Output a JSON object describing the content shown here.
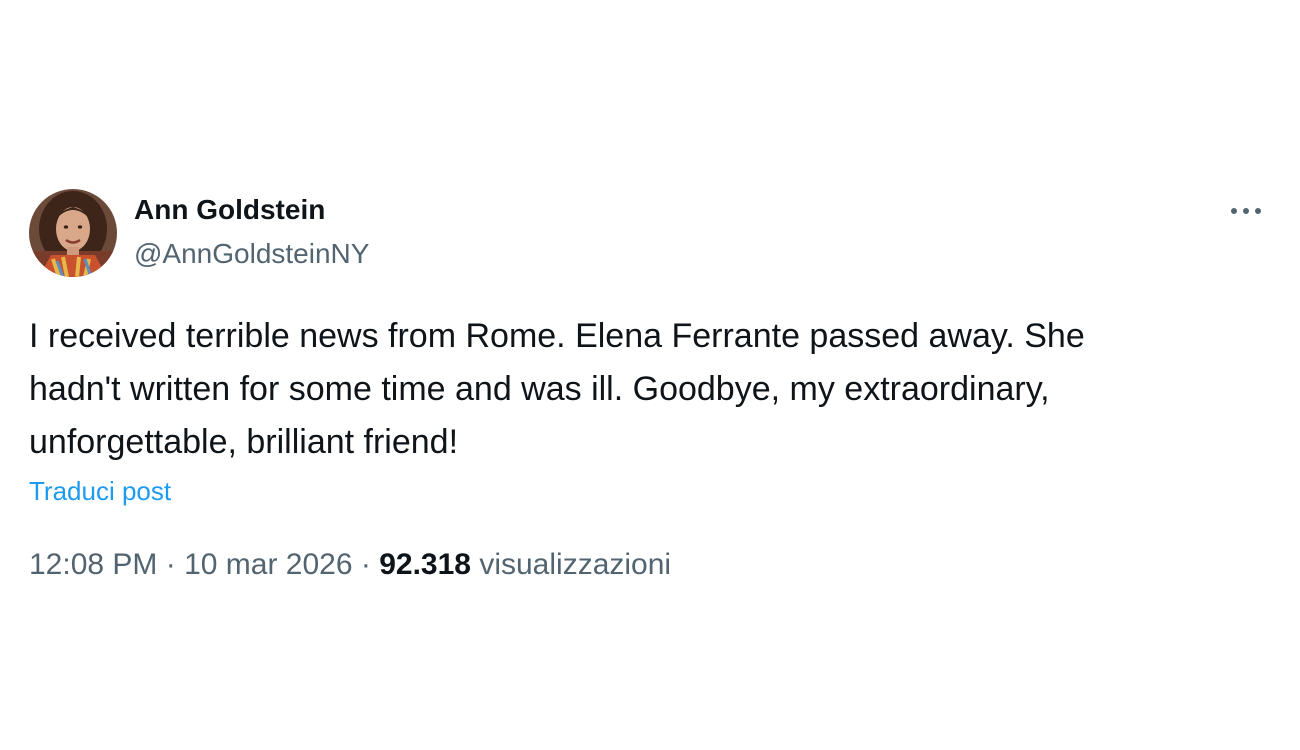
{
  "author": {
    "display_name": "Ann Goldstein",
    "handle": "@AnnGoldsteinNY",
    "avatar_icon": "person-portrait-avatar"
  },
  "more_icon": "more-horizontal-icon",
  "post": {
    "lines": [
      "I received terrible news from Rome. Elena Ferrante passed away. She",
      "hadn't written for some time and was ill. Goodbye, my extraordinary,",
      "unforgettable, brilliant friend!"
    ],
    "translate_label": "Traduci post"
  },
  "meta": {
    "time": "12:08 PM",
    "separator": "·",
    "date": "10 mar 2026",
    "views_count": "92.318",
    "views_label": "visualizzazioni"
  },
  "colors": {
    "text": "#0f1419",
    "secondary": "#536471",
    "link": "#1d9bf0"
  }
}
